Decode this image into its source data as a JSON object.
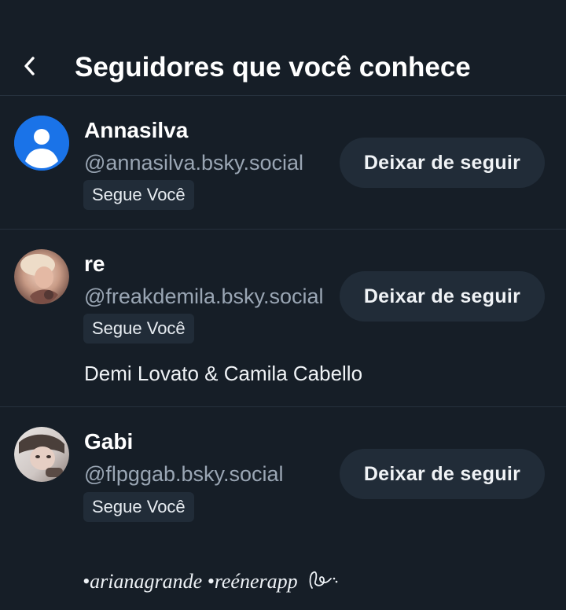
{
  "header": {
    "title": "Seguidores que você conhece",
    "back_icon": "chevron-left-icon"
  },
  "followers": [
    {
      "display_name": "Annasilva",
      "handle": "@annasilva.bsky.social",
      "badge": "Segue Você",
      "button": "Deixar de seguir",
      "avatar": "default-avatar-icon",
      "bio": ""
    },
    {
      "display_name": "re",
      "handle": "@freakdemila.bsky.social",
      "badge": "Segue Você",
      "button": "Deixar de seguir",
      "avatar": "photo",
      "bio": "Demi Lovato & Camila Cabello"
    },
    {
      "display_name": "Gabi",
      "handle": "@flpggab.bsky.social",
      "badge": "Segue Você",
      "button": "Deixar de seguir",
      "avatar": "photo",
      "bio": ""
    }
  ],
  "watermark": "•arianagrande •reénerapp",
  "colors": {
    "background": "#161e27",
    "button_bg": "#212c38",
    "divider": "#26313d",
    "handle_text": "#9aa6b4",
    "default_avatar": "#1a73e8"
  }
}
